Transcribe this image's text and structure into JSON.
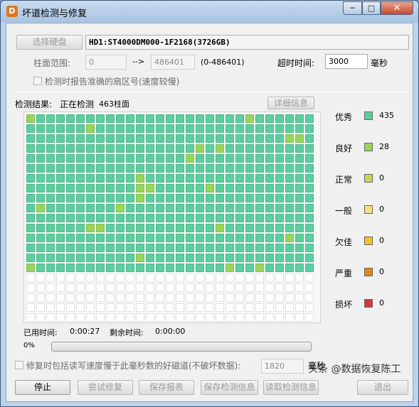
{
  "window": {
    "title": "坏道检测与修复",
    "min": "─",
    "max": "□",
    "close": "✕"
  },
  "disk": {
    "select_button": "选择硬盘",
    "name": "HD1:ST4000DM000-1F2168(3726GB)"
  },
  "range": {
    "label": "柱面范围:",
    "start": "0",
    "arrow": "-->",
    "end": "486401",
    "hint": "(0-486401)"
  },
  "timeout": {
    "label": "超时时间:",
    "value": "3000",
    "unit": "毫秒"
  },
  "report_exact_checkbox": {
    "label": "检测时报告准确的扇区号(速度较慢)"
  },
  "result": {
    "label": "检测结果:",
    "status": "正在检测",
    "cylinder": "463柱面",
    "detail_button": "详细信息"
  },
  "grid": {
    "columns": 29,
    "scanned_rows": 16,
    "total_rows": 21,
    "good_cells": [
      [
        0,
        0
      ],
      [
        0,
        22
      ],
      [
        1,
        6
      ],
      [
        2,
        26
      ],
      [
        2,
        27
      ],
      [
        3,
        17
      ],
      [
        3,
        19
      ],
      [
        4,
        16
      ],
      [
        6,
        11
      ],
      [
        7,
        11
      ],
      [
        7,
        12
      ],
      [
        7,
        18
      ],
      [
        8,
        11
      ],
      [
        9,
        1
      ],
      [
        9,
        9
      ],
      [
        11,
        6
      ],
      [
        11,
        7
      ],
      [
        11,
        19
      ],
      [
        12,
        26
      ],
      [
        14,
        11
      ],
      [
        15,
        0
      ],
      [
        15,
        20
      ],
      [
        15,
        23
      ]
    ],
    "colors": {
      "excellent": "#5bcf9f",
      "good": "#98d65a",
      "empty": "#ffffff"
    }
  },
  "legend": [
    {
      "label": "优秀",
      "count": "435",
      "color": "#5bcf9f"
    },
    {
      "label": "良好",
      "count": "28",
      "color": "#98d65a"
    },
    {
      "label": "正常",
      "count": "0",
      "color": "#c8d64f"
    },
    {
      "label": "一般",
      "count": "0",
      "color": "#f5e07a"
    },
    {
      "label": "欠佳",
      "count": "0",
      "color": "#f4c124"
    },
    {
      "label": "严重",
      "count": "0",
      "color": "#e08a1a"
    },
    {
      "label": "损坏",
      "count": "0",
      "color": "#d2393b"
    }
  ],
  "time": {
    "elapsed_label": "已用时间:",
    "elapsed": "0:00:27",
    "remaining_label": "剩余时间:",
    "remaining": "0:00:00"
  },
  "progress": {
    "percent_text": "0%",
    "value": 0
  },
  "repair_option": {
    "label": "修复时包括读写速度慢于此毫秒数的好磁道(不破坏数据):",
    "value": "1820",
    "unit": "毫秒"
  },
  "buttons": {
    "stop": "停止",
    "try_repair": "尝试修复",
    "save_report": "保存报表",
    "save_detect": "保存检测信息",
    "load_detect": "读取检测信息",
    "exit": "退出"
  },
  "watermark": "头条 @数据恢复陈工"
}
